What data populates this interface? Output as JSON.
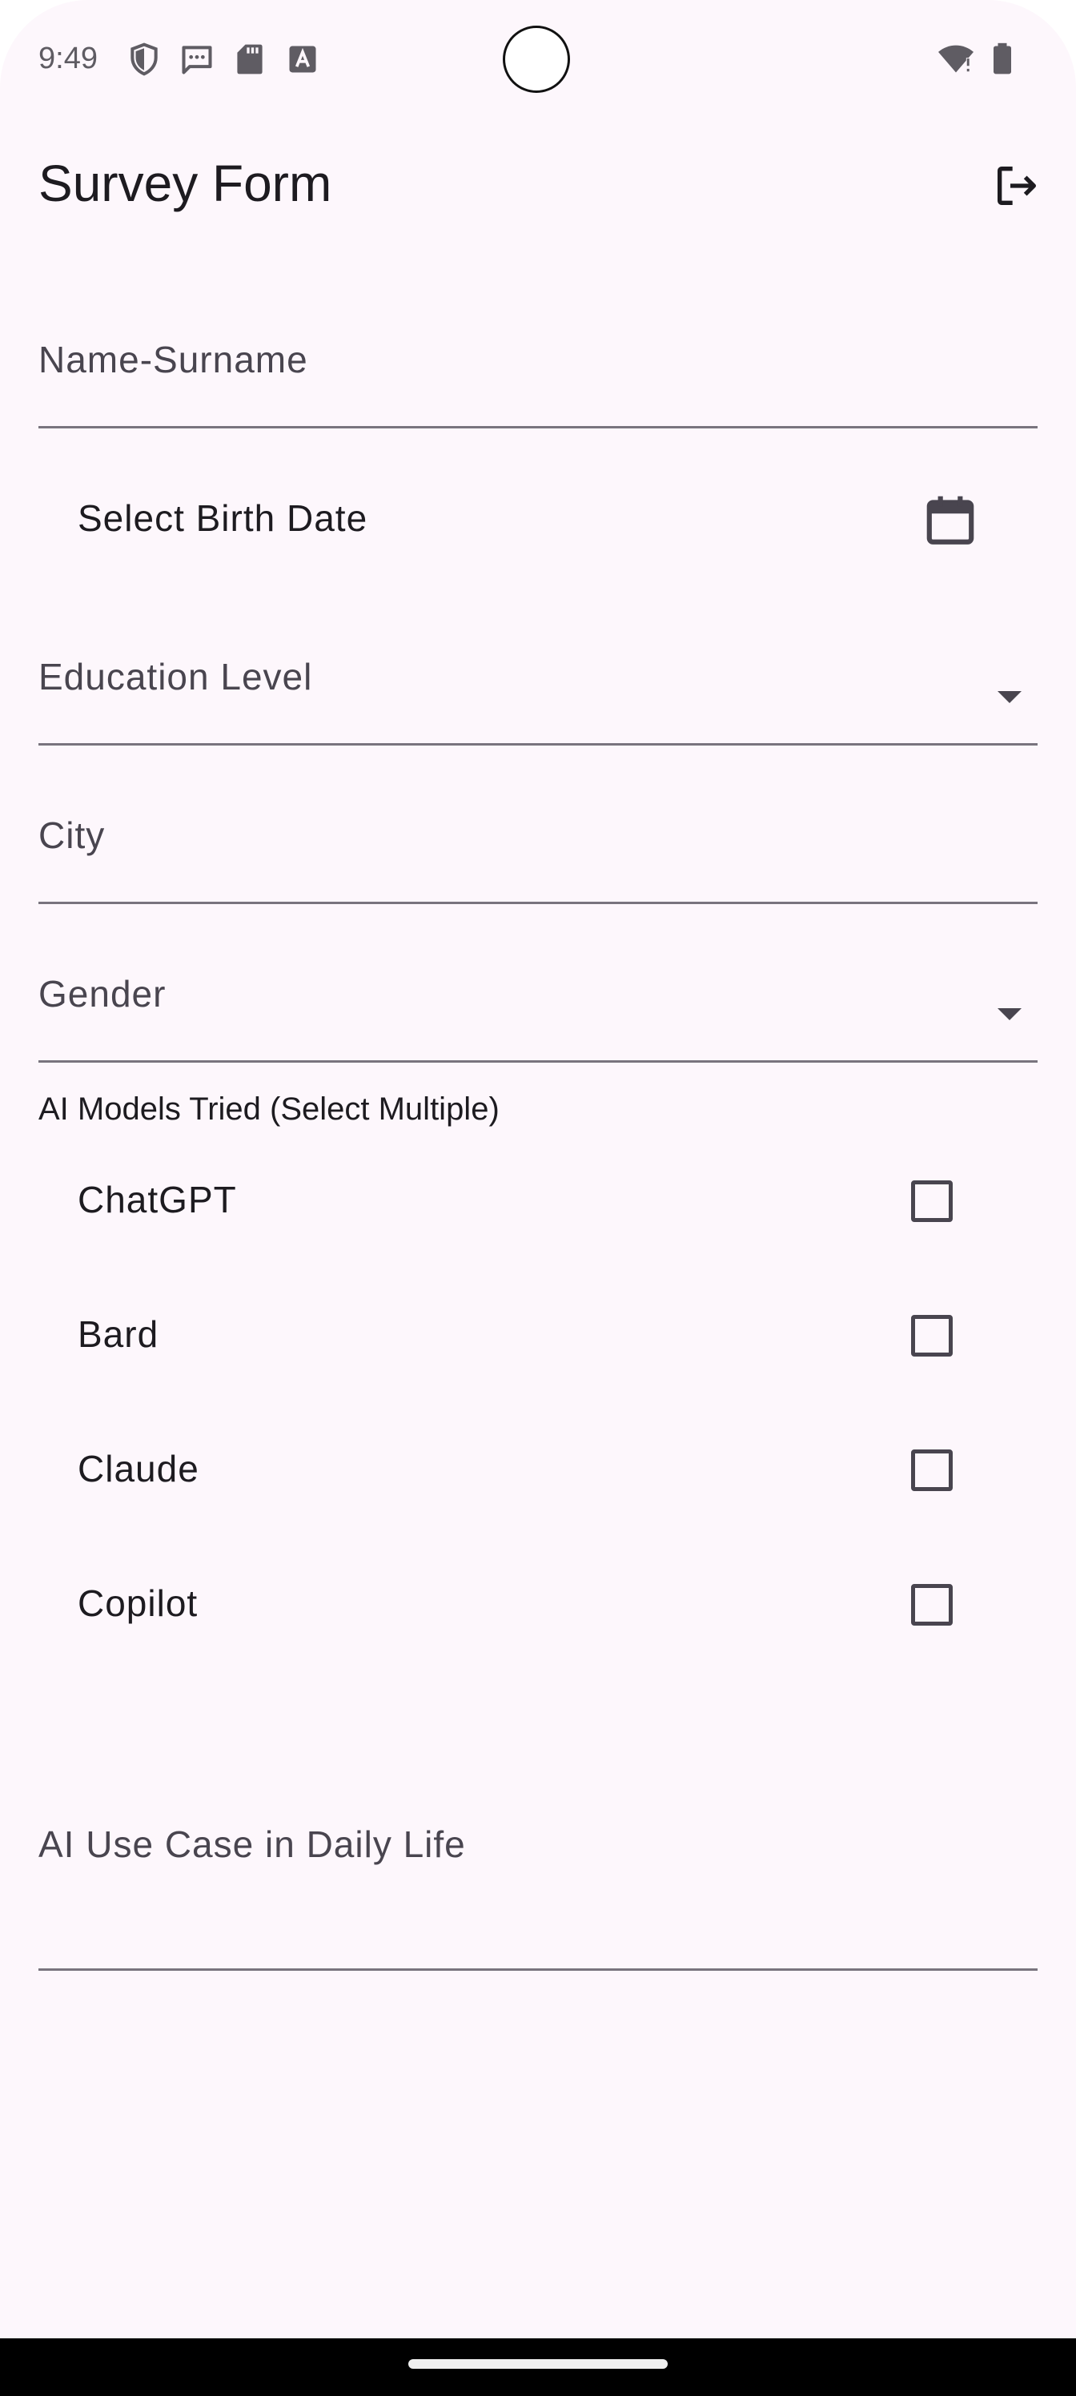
{
  "status_bar": {
    "time": "9:49",
    "icons": [
      "shield-icon",
      "message-icon",
      "sd-card-icon",
      "text-a-icon",
      "wifi-icon",
      "battery-icon"
    ]
  },
  "app_bar": {
    "title": "Survey Form",
    "logout_icon": "logout-icon"
  },
  "form": {
    "name_label": "Name-Surname",
    "birth_date_label": "Select Birth Date",
    "education_label": "Education Level",
    "city_label": "City",
    "gender_label": "Gender",
    "ai_models_label": "AI Models Tried (Select Multiple)",
    "ai_models": [
      {
        "label": "ChatGPT",
        "checked": false
      },
      {
        "label": "Bard",
        "checked": false
      },
      {
        "label": "Claude",
        "checked": false
      },
      {
        "label": "Copilot",
        "checked": false
      }
    ],
    "use_case_label": "AI Use Case in Daily Life"
  },
  "colors": {
    "background": "#fdf7fc",
    "text_primary": "#1d1b20",
    "text_secondary": "#49454f",
    "underline": "#79747e"
  }
}
